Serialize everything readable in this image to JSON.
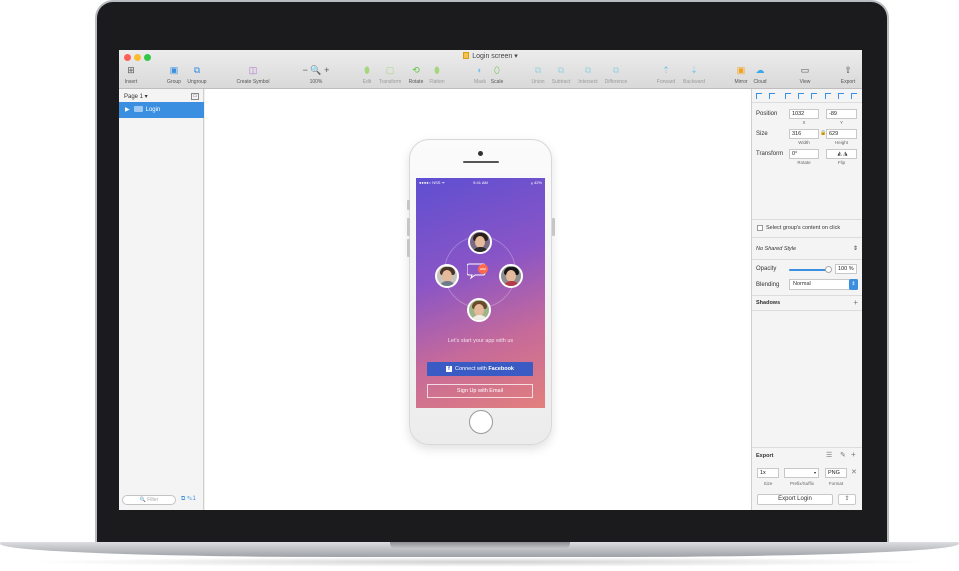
{
  "window": {
    "title": "Login screen ▾"
  },
  "toolbar": {
    "items": [
      {
        "label": "Insert",
        "icon": "plus-icon"
      },
      {
        "label": "Group",
        "icon": "group-icon"
      },
      {
        "label": "Ungroup",
        "icon": "ungroup-icon"
      },
      {
        "label": "Create Symbol",
        "icon": "symbol-icon"
      },
      {
        "label": "100%",
        "icon": "zoom-icon"
      },
      {
        "label": "Edit",
        "icon": "edit-icon"
      },
      {
        "label": "Transform",
        "icon": "transform-icon"
      },
      {
        "label": "Rotate",
        "icon": "rotate-icon"
      },
      {
        "label": "Flatten",
        "icon": "flatten-icon"
      },
      {
        "label": "Mask",
        "icon": "mask-icon"
      },
      {
        "label": "Scale",
        "icon": "scale-icon"
      },
      {
        "label": "Union",
        "icon": "union-icon"
      },
      {
        "label": "Subtract",
        "icon": "subtract-icon"
      },
      {
        "label": "Intersect",
        "icon": "intersect-icon"
      },
      {
        "label": "Difference",
        "icon": "difference-icon"
      },
      {
        "label": "Forward",
        "icon": "forward-icon"
      },
      {
        "label": "Backward",
        "icon": "backward-icon"
      },
      {
        "label": "Mirror",
        "icon": "mirror-icon"
      },
      {
        "label": "Cloud",
        "icon": "cloud-icon"
      },
      {
        "label": "View",
        "icon": "view-icon"
      },
      {
        "label": "Export",
        "icon": "export-icon"
      }
    ],
    "zoom_symbols": "− 🔍 +"
  },
  "left_panel": {
    "page": "Page 1 ▾",
    "layer": "Login",
    "filter_placeholder": "🔍 Filter",
    "filter_count": "1"
  },
  "phone": {
    "status_left": "●●●●○ NSS ᯤ",
    "status_time": "9:41 AM",
    "status_right": "⁎ 42%",
    "tagline": "Let's start your app with us",
    "fb_prefix": "Connect with ",
    "fb_bold": "Facebook",
    "email_button": "Sign Up with Email"
  },
  "inspector": {
    "position_label": "Position",
    "position_x": "1032",
    "position_y": "-89",
    "x_label": "X",
    "y_label": "Y",
    "size_label": "Size",
    "width": "316",
    "height": "629",
    "width_label": "Width",
    "height_label": "Height",
    "transform_label": "Transform",
    "rotate_value": "0°",
    "rotate_label": "Rotate",
    "flip_label": "Flip",
    "select_content": "Select group's content on click",
    "shared_style": "No Shared Style",
    "opacity_label": "Opacity",
    "opacity_value": "100 %",
    "opacity_level": 1.0,
    "blending_label": "Blending",
    "blending_value": "Normal",
    "shadows_label": "Shadows",
    "export_label": "Export",
    "export_size": "1x",
    "export_prefix": "",
    "export_format": "PNG",
    "size_sub": "Size",
    "prefix_sub": "Prefix/Suffix",
    "format_sub": "Format",
    "export_button": "Export Login"
  },
  "colors": {
    "accent": "#3a8fe0",
    "facebook": "#3a5bc3",
    "gradient_top": "#5e4fd1",
    "gradient_bottom": "#e27f7d"
  }
}
